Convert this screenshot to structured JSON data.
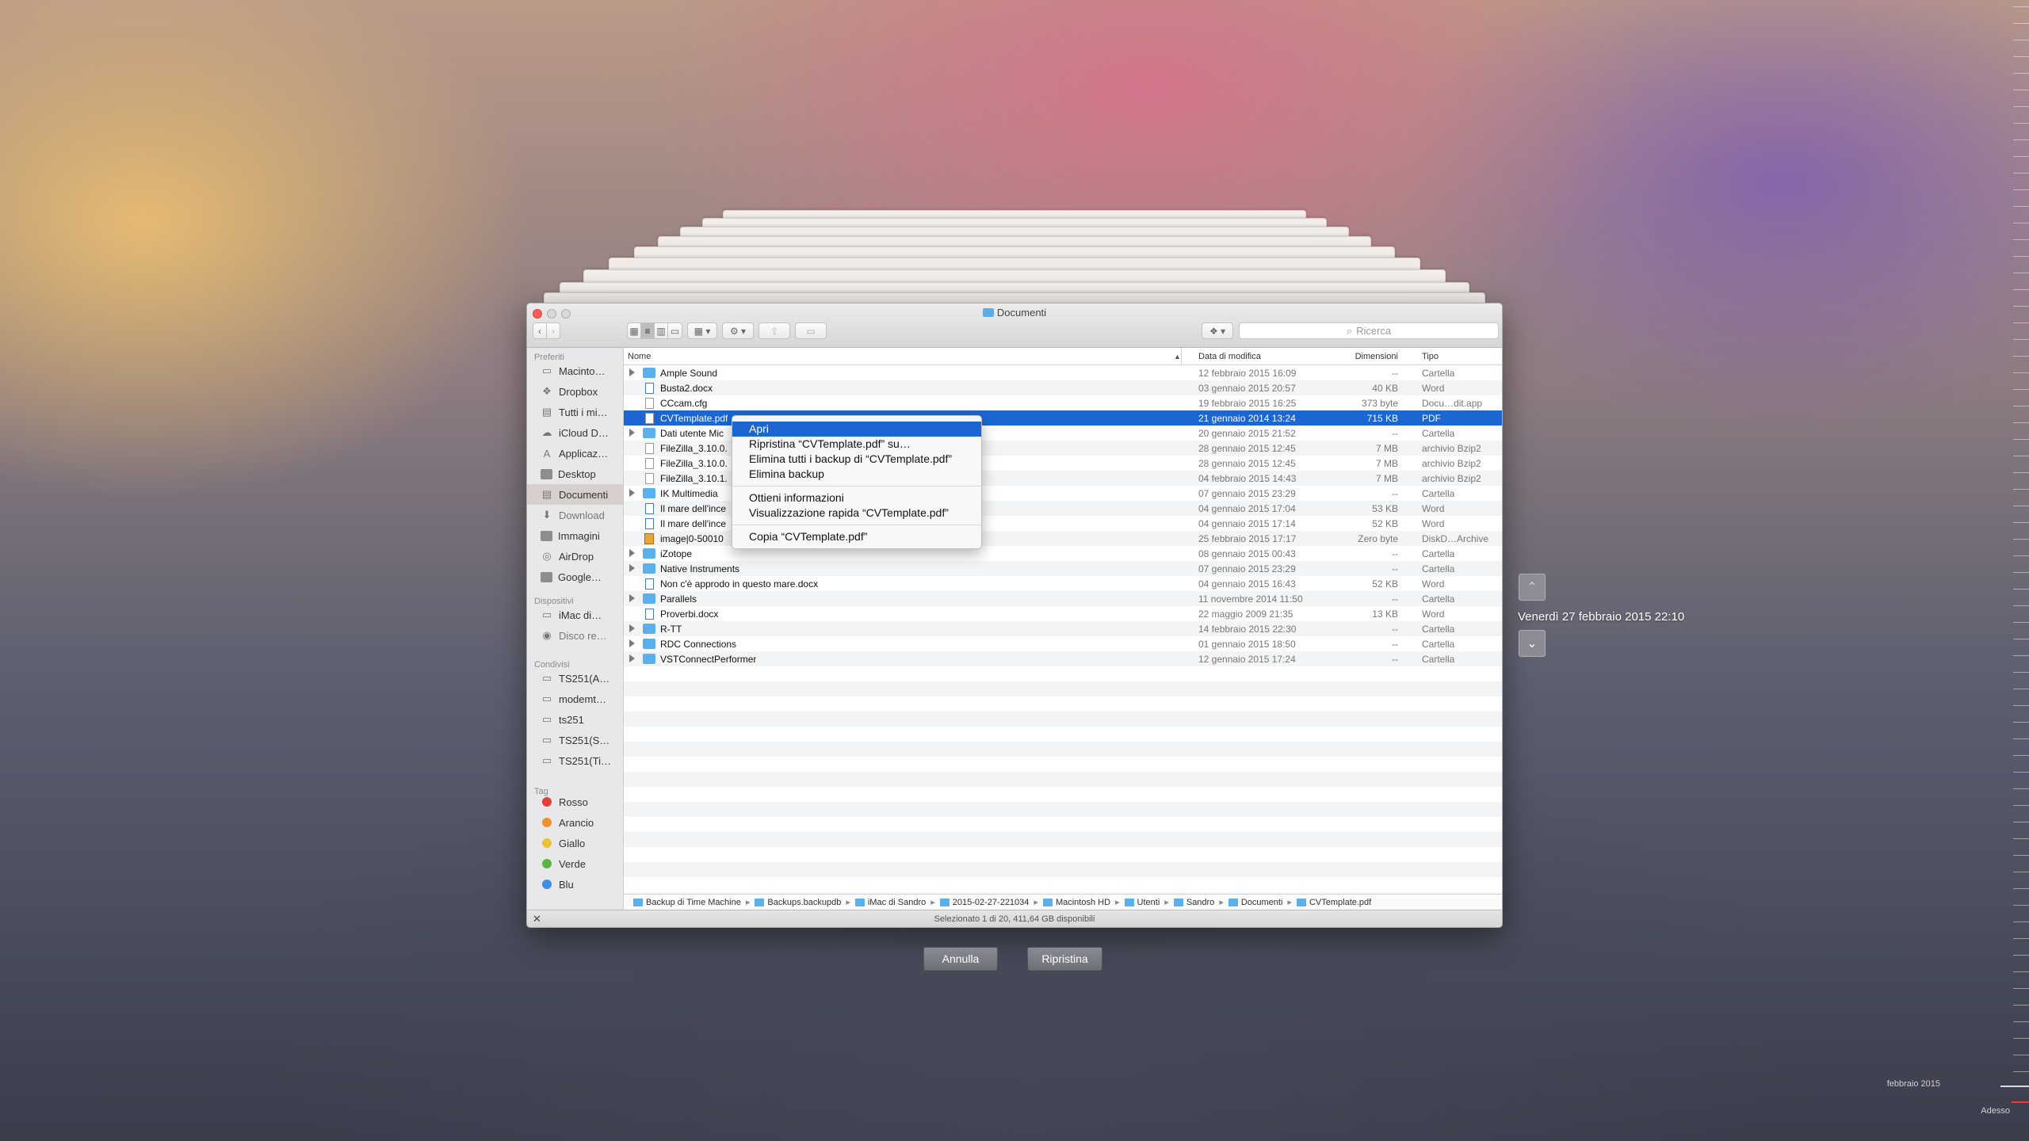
{
  "window": {
    "title": "Documenti"
  },
  "search": {
    "placeholder": "Ricerca"
  },
  "sidebar": {
    "favorites_header": "Preferiti",
    "favorites": [
      {
        "label": "Macinto…",
        "icon": "hard-drive-icon"
      },
      {
        "label": "Dropbox",
        "icon": "dropbox-icon"
      },
      {
        "label": "Tutti i mi…",
        "icon": "all-files-icon"
      },
      {
        "label": "iCloud D…",
        "icon": "cloud-icon"
      },
      {
        "label": "Applicaz…",
        "icon": "applications-icon"
      },
      {
        "label": "Desktop",
        "icon": "desktop-icon"
      },
      {
        "label": "Documenti",
        "icon": "documents-icon"
      },
      {
        "label": "Download",
        "icon": "download-icon"
      },
      {
        "label": "Immagini",
        "icon": "pictures-icon"
      },
      {
        "label": "AirDrop",
        "icon": "airdrop-icon"
      },
      {
        "label": "Google…",
        "icon": "drive-icon"
      }
    ],
    "devices_header": "Dispositivi",
    "devices": [
      {
        "label": "iMac di…",
        "icon": "imac-icon"
      },
      {
        "label": "Disco re…",
        "icon": "disc-icon"
      }
    ],
    "shared_header": "Condivisi",
    "shared": [
      {
        "label": "TS251(A…",
        "icon": "server-icon"
      },
      {
        "label": "modemt…",
        "icon": "server-icon"
      },
      {
        "label": "ts251",
        "icon": "server-icon"
      },
      {
        "label": "TS251(S…",
        "icon": "server-icon"
      },
      {
        "label": "TS251(Ti…",
        "icon": "server-icon"
      }
    ],
    "tags_header": "Tag",
    "tags": [
      {
        "label": "Rosso",
        "color": "#e0403a"
      },
      {
        "label": "Arancio",
        "color": "#f0912e"
      },
      {
        "label": "Giallo",
        "color": "#e8c234"
      },
      {
        "label": "Verde",
        "color": "#5ab640"
      },
      {
        "label": "Blu",
        "color": "#3a8ee6"
      }
    ]
  },
  "columns": {
    "name": "Nome",
    "date": "Data di modifica",
    "size": "Dimensioni",
    "type": "Tipo"
  },
  "files": [
    {
      "name": "Ample Sound",
      "date": "12 febbraio 2015 16:09",
      "size": "--",
      "type": "Cartella",
      "kind": "folder",
      "expandable": true
    },
    {
      "name": "Busta2.docx",
      "date": "03 gennaio 2015 20:57",
      "size": "40 KB",
      "type": "Word",
      "kind": "word",
      "expandable": false
    },
    {
      "name": "CCcam.cfg",
      "date": "19 febbraio 2015 16:25",
      "size": "373 byte",
      "type": "Docu…dit.app",
      "kind": "doc",
      "expandable": false
    },
    {
      "name": "CVTemplate.pdf",
      "date": "21 gennaio 2014 13:24",
      "size": "715 KB",
      "type": "PDF",
      "kind": "doc",
      "expandable": false,
      "selected": true
    },
    {
      "name": "Dati utente Mic",
      "date": "20 gennaio 2015 21:52",
      "size": "--",
      "type": "Cartella",
      "kind": "folder",
      "expandable": true
    },
    {
      "name": "FileZilla_3.10.0.",
      "date": "28 gennaio 2015 12:45",
      "size": "7 MB",
      "type": "archivio Bzip2",
      "kind": "doc",
      "expandable": false
    },
    {
      "name": "FileZilla_3.10.0.",
      "date": "28 gennaio 2015 12:45",
      "size": "7 MB",
      "type": "archivio Bzip2",
      "kind": "doc",
      "expandable": false
    },
    {
      "name": "FileZilla_3.10.1.",
      "date": "04 febbraio 2015 14:43",
      "size": "7 MB",
      "type": "archivio Bzip2",
      "kind": "doc",
      "expandable": false
    },
    {
      "name": "IK Multimedia",
      "date": "07 gennaio 2015 23:29",
      "size": "--",
      "type": "Cartella",
      "kind": "folder",
      "expandable": true
    },
    {
      "name": "Il mare dell'ince",
      "date": "04 gennaio 2015 17:04",
      "size": "53 KB",
      "type": "Word",
      "kind": "word",
      "expandable": false
    },
    {
      "name": "Il mare dell'ince",
      "date": "04 gennaio 2015 17:14",
      "size": "52 KB",
      "type": "Word",
      "kind": "word",
      "expandable": false
    },
    {
      "name": "image|0-50010",
      "date": "25 febbraio 2015 17:17",
      "size": "Zero byte",
      "type": "DiskD…Archive",
      "kind": "gold",
      "expandable": false
    },
    {
      "name": "iZotope",
      "date": "08 gennaio 2015 00:43",
      "size": "--",
      "type": "Cartella",
      "kind": "folder",
      "expandable": true
    },
    {
      "name": "Native Instruments",
      "date": "07 gennaio 2015 23:29",
      "size": "--",
      "type": "Cartella",
      "kind": "folder",
      "expandable": true
    },
    {
      "name": "Non c'è approdo in questo mare.docx",
      "date": "04 gennaio 2015 16:43",
      "size": "52 KB",
      "type": "Word",
      "kind": "word",
      "expandable": false
    },
    {
      "name": "Parallels",
      "date": "11 novembre 2014 11:50",
      "size": "--",
      "type": "Cartella",
      "kind": "folder",
      "expandable": true
    },
    {
      "name": "Proverbi.docx",
      "date": "22 maggio 2009 21:35",
      "size": "13 KB",
      "type": "Word",
      "kind": "word",
      "expandable": false
    },
    {
      "name": "R-TT",
      "date": "14 febbraio 2015 22:30",
      "size": "--",
      "type": "Cartella",
      "kind": "folder",
      "expandable": true
    },
    {
      "name": "RDC Connections",
      "date": "01 gennaio 2015 18:50",
      "size": "--",
      "type": "Cartella",
      "kind": "folder",
      "expandable": true
    },
    {
      "name": "VSTConnectPerformer",
      "date": "12 gennaio 2015 17:24",
      "size": "--",
      "type": "Cartella",
      "kind": "folder",
      "expandable": true
    }
  ],
  "context_menu": [
    {
      "label": "Apri"
    },
    {
      "label": "Ripristina “CVTemplate.pdf” su…"
    },
    {
      "label": "Elimina tutti i backup di “CVTemplate.pdf”"
    },
    {
      "label": "Elimina backup"
    },
    {
      "label": "Ottieni informazioni"
    },
    {
      "label": "Visualizzazione rapida “CVTemplate.pdf”"
    },
    {
      "label": "Copia “CVTemplate.pdf”"
    }
  ],
  "path_bar": [
    "Backup di Time Machine",
    "Backups.backupdb",
    "iMac di Sandro",
    "2015-02-27-221034",
    "Macintosh HD",
    "Utenti",
    "Sandro",
    "Documenti",
    "CVTemplate.pdf"
  ],
  "status": "Selezionato 1 di 20, 411,64 GB disponibili",
  "buttons": {
    "cancel": "Annulla",
    "restore": "Ripristina"
  },
  "timemachine": {
    "current_date": "Venerdì 27 febbraio 2015 22:10",
    "timeline_month": "febbraio 2015",
    "timeline_now": "Adesso"
  }
}
